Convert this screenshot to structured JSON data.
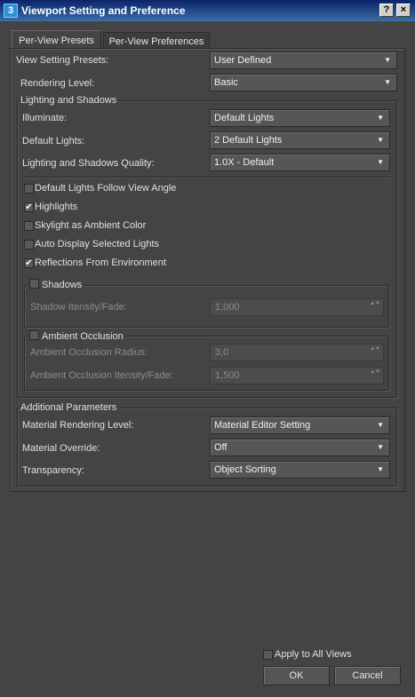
{
  "window": {
    "title": "Viewport Setting and Preference",
    "app_icon": "3",
    "help_label": "?",
    "close_label": "×"
  },
  "tabs": [
    "Per-View Presets",
    "Per-View Preferences"
  ],
  "view_setting_presets": {
    "label": "View Setting Presets:",
    "value": "User Defined"
  },
  "rendering_level": {
    "label": "Rendering Level:",
    "value": "Basic"
  },
  "lighting": {
    "title": "Lighting and Shadows",
    "illuminate": {
      "label": "Illuminate:",
      "value": "Default Lights"
    },
    "default_lights": {
      "label": "Default Lights:",
      "value": "2 Default Lights"
    },
    "quality": {
      "label": "Lighting and Shadows Quality:",
      "value": "1.0X - Default"
    },
    "checkboxes": [
      {
        "label": "Default Lights Follow View Angle",
        "checked": false
      },
      {
        "label": "Highlights",
        "checked": true
      },
      {
        "label": "Skylight as Ambient Color",
        "checked": false
      },
      {
        "label": "Auto Display Selected Lights",
        "checked": false
      },
      {
        "label": "Reflections From Environment",
        "checked": true
      }
    ],
    "shadows": {
      "title": "Shadows",
      "enabled": false,
      "intensity_label": "Shadow Itensity/Fade:",
      "intensity_value": "1,000"
    },
    "ambient_occlusion": {
      "title": "Ambient Occlusion",
      "enabled": false,
      "radius_label": "Ambient Occlusion Radius:",
      "radius_value": "3,0",
      "intensity_label": "Ambient Occlusion Itensity/Fade:",
      "intensity_value": "1,500"
    }
  },
  "additional": {
    "title": "Additional Parameters",
    "material_rendering_level": {
      "label": "Material Rendering Level:",
      "value": "Material Editor Setting"
    },
    "material_override": {
      "label": "Material Override:",
      "value": "Off"
    },
    "transparency": {
      "label": "Transparency:",
      "value": "Object Sorting"
    }
  },
  "footer": {
    "apply_label": "Apply to All Views",
    "apply_checked": false,
    "ok_label": "OK",
    "cancel_label": "Cancel"
  },
  "icons": {
    "dropdown_arrow": "▼",
    "spinner": "▲▼",
    "check": "✔"
  },
  "colors": {
    "title_bar_start": "#0a246a",
    "title_bar_end": "#3a6ea5",
    "background": "#444444",
    "text": "#dcdcdc",
    "disabled_text": "#8c8c8c"
  }
}
